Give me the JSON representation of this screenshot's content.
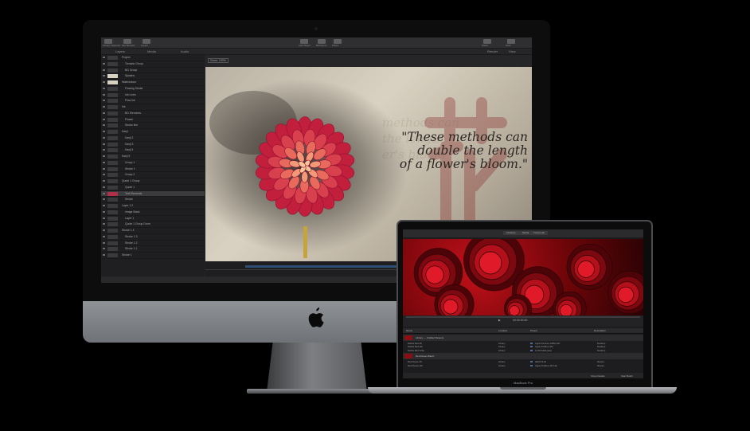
{
  "imac": {
    "motion": {
      "toolbar": [
        {
          "icon": "library-icon",
          "label": "Library Inspector"
        },
        {
          "icon": "file-browser-icon",
          "label": "File Browser"
        },
        {
          "icon": "layers-icon",
          "label": "Layers"
        },
        {
          "icon": "add-object-icon",
          "label": "Add Object"
        },
        {
          "icon": "behaviors-icon",
          "label": "Behaviors"
        },
        {
          "icon": "filters-icon",
          "label": "Filters"
        },
        {
          "icon": "share-icon",
          "label": "Share"
        },
        {
          "icon": "hud-icon",
          "label": "HUD"
        }
      ],
      "subbar": {
        "tab1": "Layers",
        "tab2": "Media",
        "tab3": "Audio",
        "zoom": "Render",
        "view": "View"
      },
      "canvas_label": "Zoom: 100%",
      "layers": [
        {
          "name": "Project",
          "selected": false
        },
        {
          "name": "Tornado Group",
          "selected": false
        },
        {
          "name": "BG Group",
          "selected": false
        },
        {
          "name": "Splashs",
          "selected": false
        },
        {
          "name": "Watercolour",
          "selected": false
        },
        {
          "name": "Flowing Stroke",
          "selected": false
        },
        {
          "name": "Ink Lines",
          "selected": false
        },
        {
          "name": "Flow Ink",
          "selected": false
        },
        {
          "name": "Ink",
          "selected": false
        },
        {
          "name": "BG Elements",
          "selected": false
        },
        {
          "name": "Flower",
          "selected": false
        },
        {
          "name": "Stroke line",
          "selected": false
        },
        {
          "name": "Kanji",
          "selected": false
        },
        {
          "name": "Kanji 2",
          "selected": false
        },
        {
          "name": "Kanji 3",
          "selected": false
        },
        {
          "name": "Kanji 4",
          "selected": false
        },
        {
          "name": "Kanji 5",
          "selected": false
        },
        {
          "name": "Group 1",
          "selected": false
        },
        {
          "name": "Stroke 1",
          "selected": false
        },
        {
          "name": "Group 2",
          "selected": false
        },
        {
          "name": "Quote 1 Group",
          "selected": false
        },
        {
          "name": "Quote 1",
          "selected": false
        },
        {
          "name": "Text Elements",
          "selected": true
        },
        {
          "name": "Stroke",
          "selected": false
        },
        {
          "name": "Layer 1.2",
          "selected": false
        },
        {
          "name": "Image Mask",
          "selected": false
        },
        {
          "name": "Layer 1",
          "selected": false
        },
        {
          "name": "Quote 1 Group Drum",
          "selected": false
        },
        {
          "name": "Stroke 1.4",
          "selected": false
        },
        {
          "name": "Stroke 1.3",
          "selected": false
        },
        {
          "name": "Stroke 1.2",
          "selected": false
        },
        {
          "name": "Stroke 1.1",
          "selected": false
        },
        {
          "name": "Stroke 1",
          "selected": false
        }
      ],
      "quote": [
        "\"These methods can",
        "double the length",
        "of a flower's bloom.\""
      ],
      "ghost": [
        "methods can",
        "the length",
        "er's bloom"
      ]
    }
  },
  "macbook": {
    "label": "MacBook Pro",
    "fcp": {
      "tabs": [
        "Libraries",
        "Media",
        "Transcode"
      ],
      "title": "Batch Export",
      "transport": {
        "timecode": "00:00:00:00",
        "play": "▶"
      },
      "list_header": [
        "Name",
        "Location",
        "Preset",
        "Destination"
      ],
      "group1": {
        "title": "Library — Untitled Flowers"
      },
      "rows1": [
        {
          "name": "Dahlia Red 4K",
          "loc": "Library",
          "preset": "Apple Devices 1080p HD",
          "dest": "Desktop"
        },
        {
          "name": "Dahlia Red HD",
          "loc": "Library",
          "preset": "Apple ProRes 422",
          "dest": "Desktop"
        },
        {
          "name": "Dahlia Red 720p",
          "loc": "Library",
          "preset": "H.264 Multi-pass",
          "dest": "Desktop"
        }
      ],
      "group2": {
        "title": "Red Roses Batch"
      },
      "rows2": [
        {
          "name": "Red Roses 4K",
          "loc": "Library",
          "preset": "HEVC 8-bit",
          "dest": "Movies"
        },
        {
          "name": "Red Roses HD",
          "loc": "Library",
          "preset": "Apple ProRes 422 HQ",
          "dest": "Movies"
        }
      ],
      "footer": {
        "left": "Show Details",
        "right": "Start Batch"
      }
    }
  }
}
